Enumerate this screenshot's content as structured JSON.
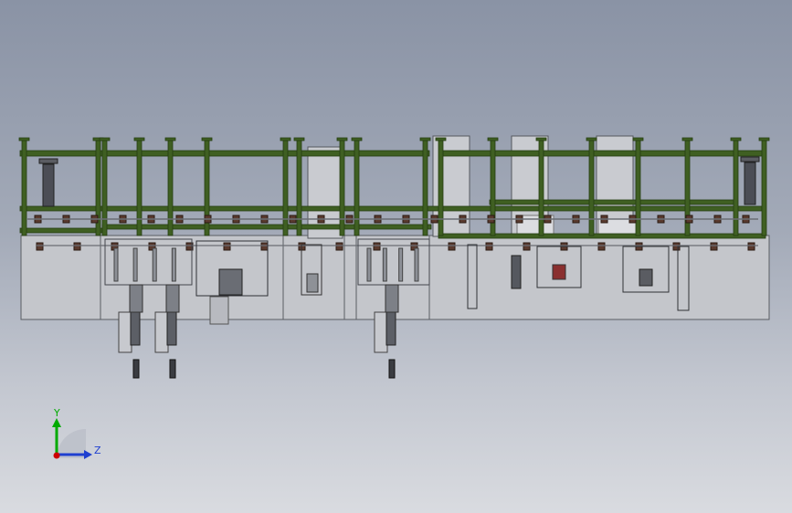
{
  "triad": {
    "y_label": "Y",
    "z_label": "Z"
  },
  "colors": {
    "frame_green": "#3f5f22",
    "frame_green_dark": "#263d12",
    "base_fill": "#c4c6cb",
    "base_line": "#5a5d63",
    "panel_fill": "#c9cbd0",
    "mechanism": "#3d3f44",
    "bracket": "#5a3a2e",
    "axis_y": "#00aa00",
    "axis_z": "#1f3fd0",
    "origin": "#cc0000"
  }
}
